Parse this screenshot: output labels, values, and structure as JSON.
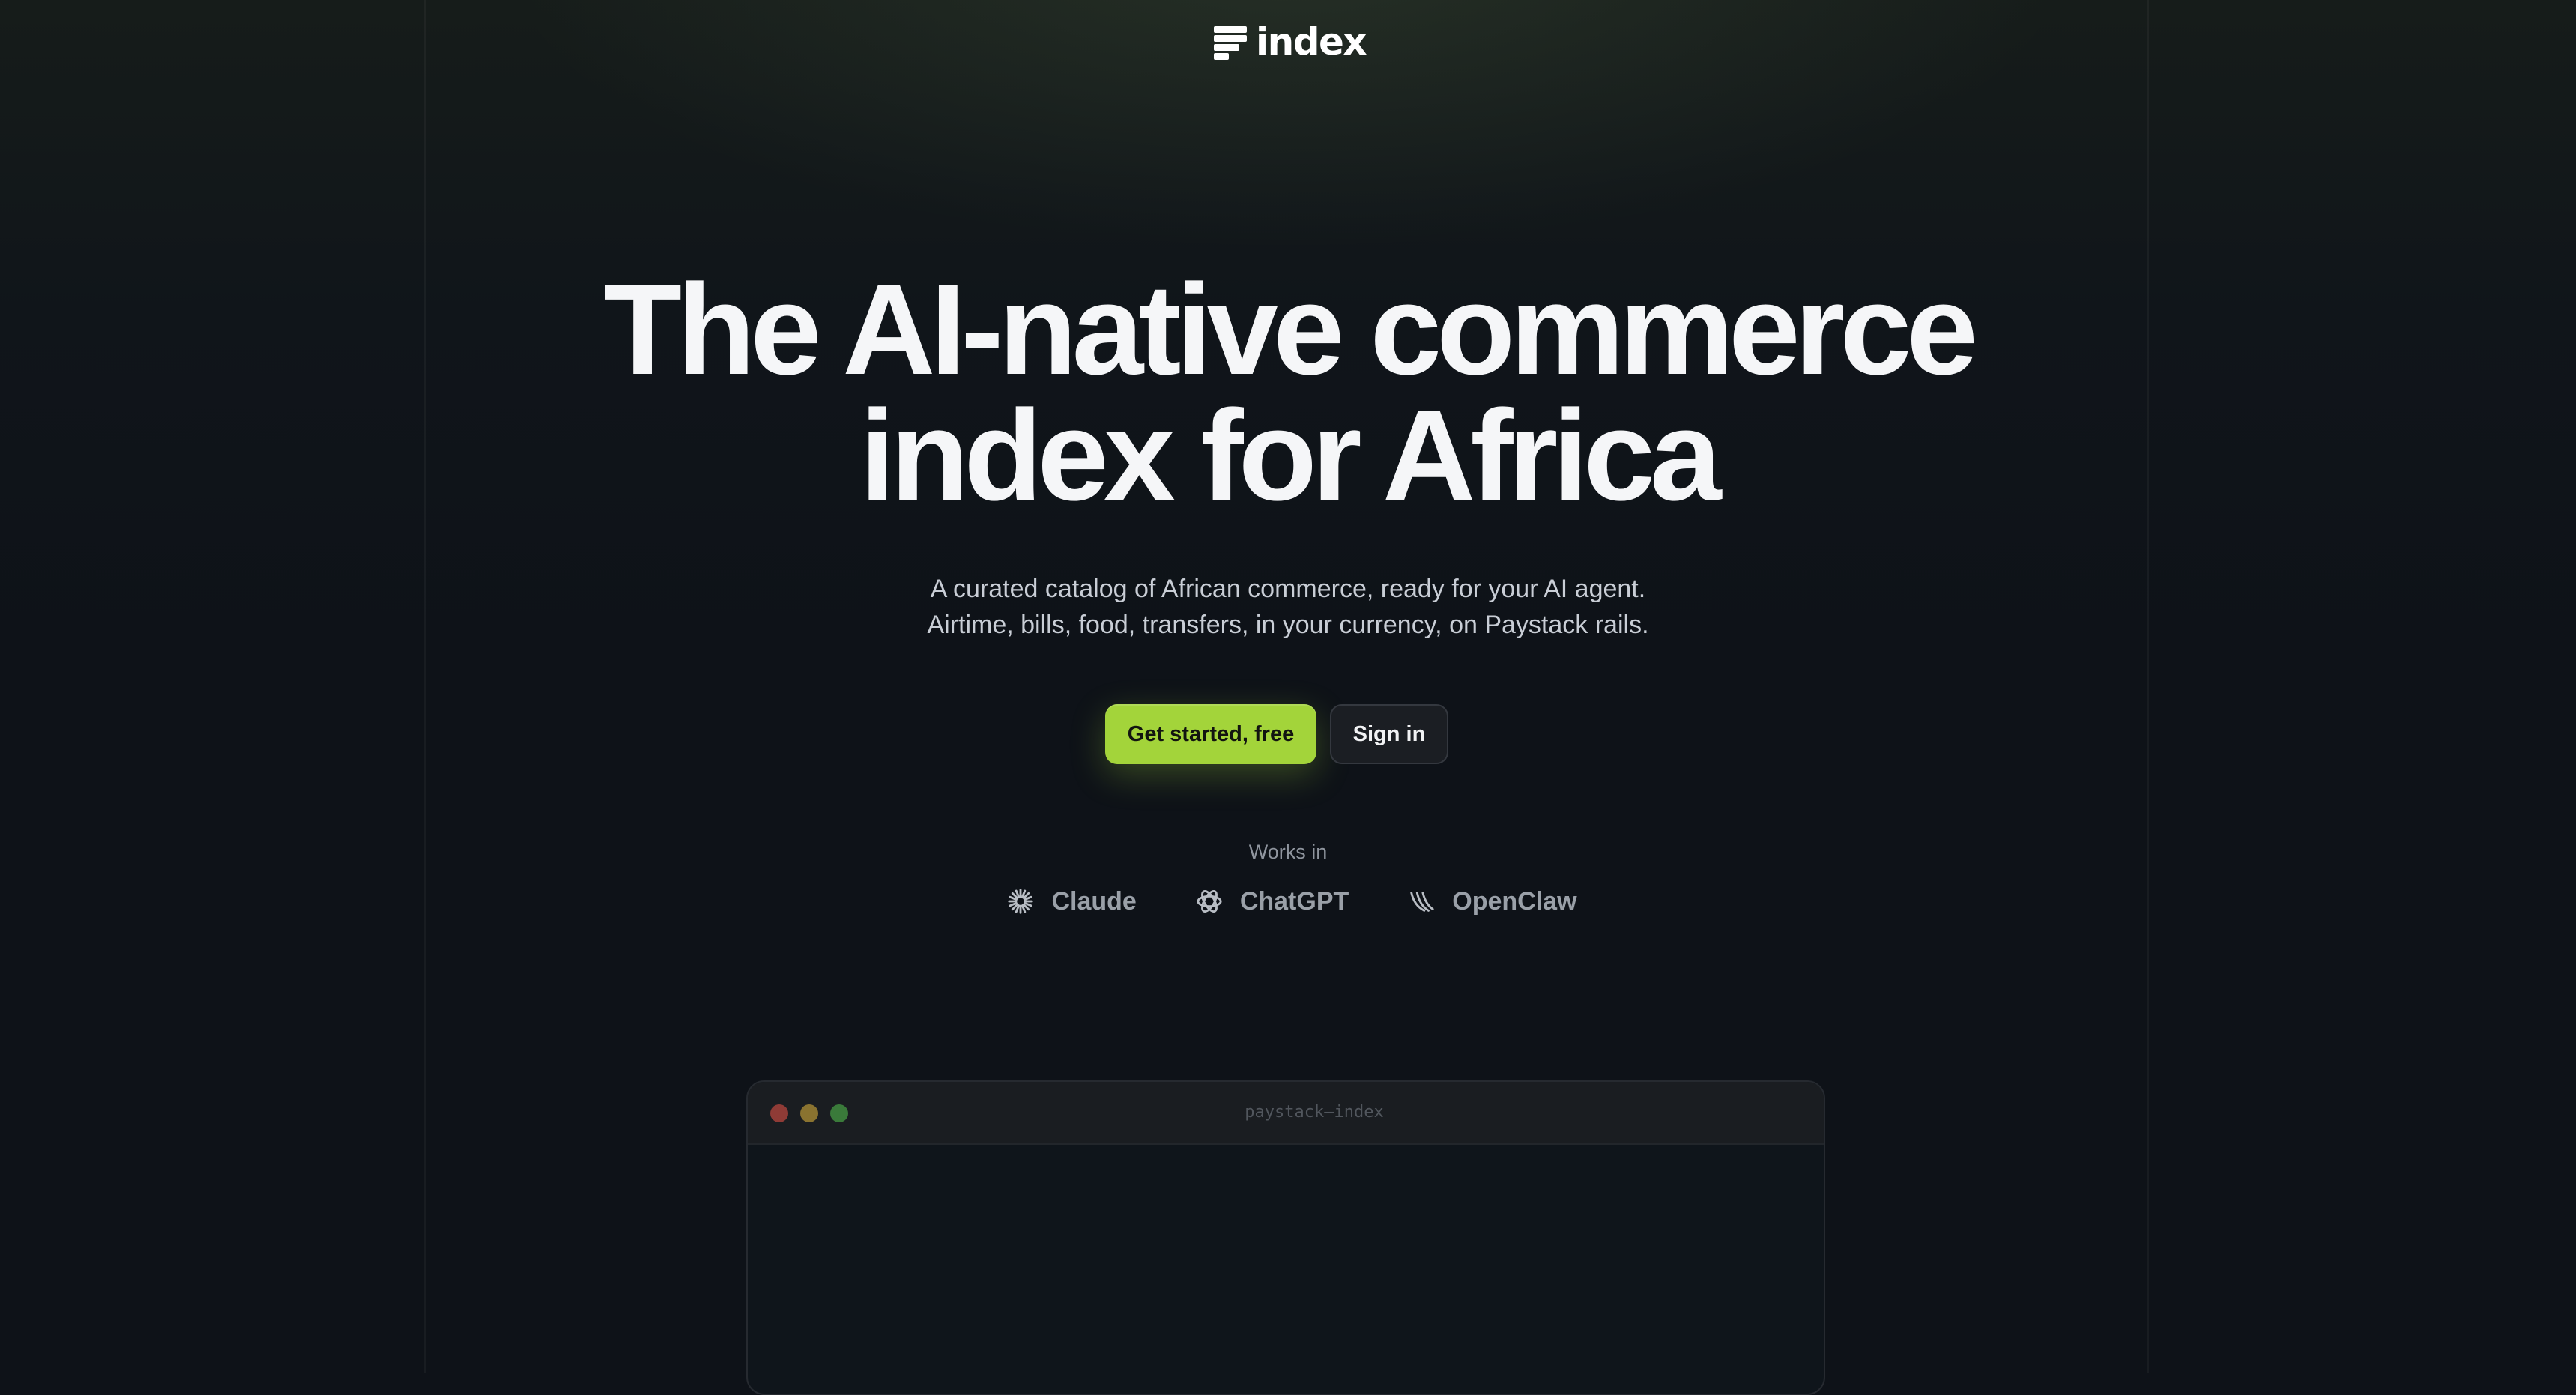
{
  "header": {
    "logo_text": "index"
  },
  "hero": {
    "title_line1": "The AI-native commerce",
    "title_line2": "index for Africa",
    "subtitle_line1": "A curated catalog of African commerce, ready for your AI agent.",
    "subtitle_line2": "Airtime, bills, food, transfers, in your currency, on Paystack rails."
  },
  "cta": {
    "primary_label": "Get started, free",
    "secondary_label": "Sign in"
  },
  "works_in": {
    "label": "Works in",
    "items": [
      {
        "name": "Claude",
        "icon": "claude-icon"
      },
      {
        "name": "ChatGPT",
        "icon": "chatgpt-icon"
      },
      {
        "name": "OpenClaw",
        "icon": "openclaw-icon"
      }
    ]
  },
  "terminal": {
    "title": "paystack—index"
  },
  "colors": {
    "background": "#0e1218",
    "accent": "#a3d43a",
    "text_primary": "#f5f6f8",
    "text_muted": "#9aa0a8"
  }
}
